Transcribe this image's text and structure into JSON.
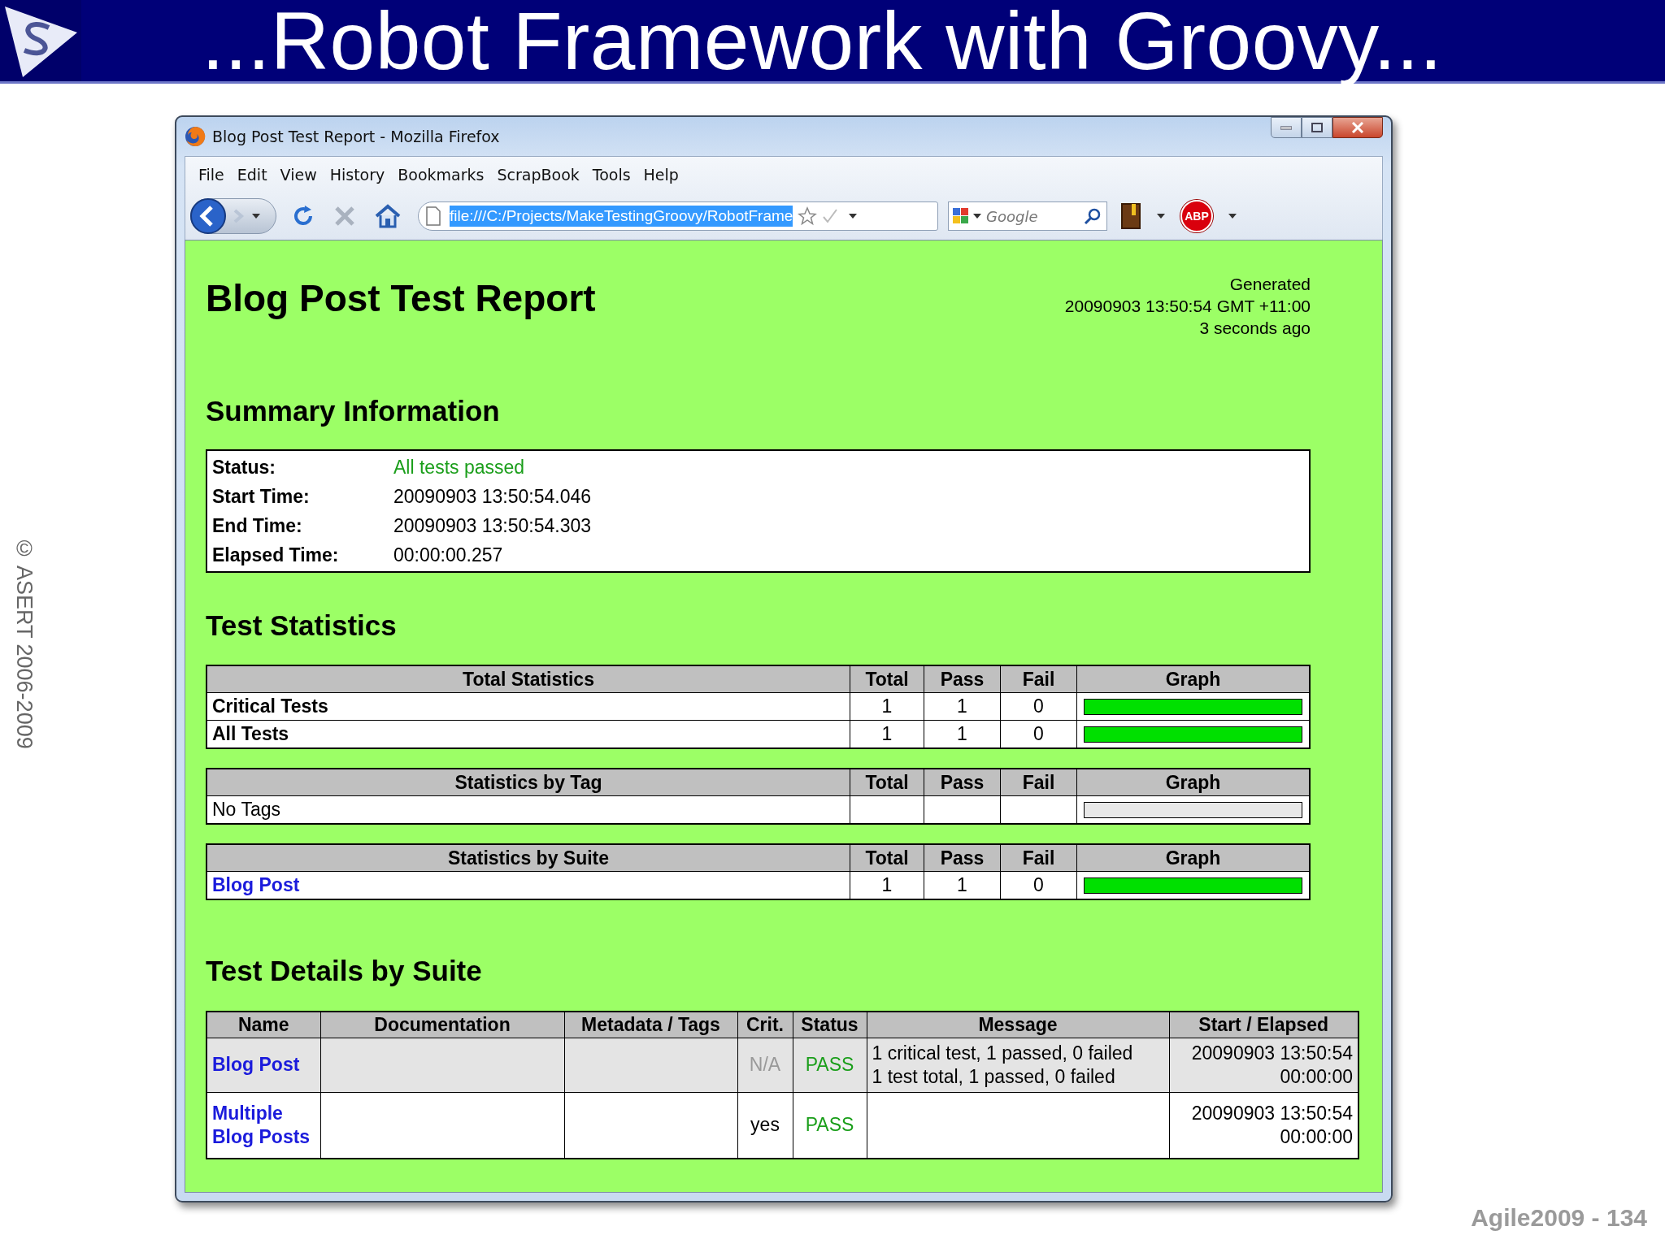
{
  "slide": {
    "title": "...Robot Framework with Groovy...",
    "copyright": "© ASERT 2006-2009",
    "footer": "Agile2009 - 134"
  },
  "browser": {
    "title": "Blog Post Test Report - Mozilla Firefox",
    "menu": [
      "File",
      "Edit",
      "View",
      "History",
      "Bookmarks",
      "ScrapBook",
      "Tools",
      "Help"
    ],
    "address": {
      "value": "file:///C:/Projects/MakeTestingGroovy/RobotFrame",
      "selected": true
    },
    "search": {
      "placeholder": "Google"
    },
    "addon_badge": "ABP"
  },
  "report": {
    "title": "Blog Post Test Report",
    "generated": [
      "Generated",
      "20090903 13:50:54 GMT +11:00",
      "3 seconds ago"
    ],
    "summary": {
      "heading": "Summary Information",
      "rows": [
        {
          "label": "Status:",
          "value": "All tests passed",
          "kind": "status"
        },
        {
          "label": "Start Time:",
          "value": "20090903 13:50:54.046",
          "kind": "plain"
        },
        {
          "label": "End Time:",
          "value": "20090903 13:50:54.303",
          "kind": "plain"
        },
        {
          "label": "Elapsed Time:",
          "value": "00:00:00.257",
          "kind": "plain"
        }
      ]
    },
    "statistics_heading": "Test Statistics",
    "statistics": [
      {
        "columns": [
          "Total Statistics",
          "Total",
          "Pass",
          "Fail",
          "Graph"
        ],
        "rows": [
          {
            "name": "Critical Tests",
            "kind": "bold",
            "total": "1",
            "pass": "1",
            "fail": "0",
            "level": 1
          },
          {
            "name": "All Tests",
            "kind": "bold",
            "total": "1",
            "pass": "1",
            "fail": "0",
            "level": 1
          }
        ]
      },
      {
        "columns": [
          "Statistics by Tag",
          "Total",
          "Pass",
          "Fail",
          "Graph"
        ],
        "rows": [
          {
            "name": "No Tags",
            "kind": "plain",
            "level": 0
          }
        ]
      },
      {
        "columns": [
          "Statistics by Suite",
          "Total",
          "Pass",
          "Fail",
          "Graph"
        ],
        "rows": [
          {
            "name": "Blog Post",
            "kind": "link",
            "total": "1",
            "pass": "1",
            "fail": "0",
            "level": 1
          }
        ]
      }
    ],
    "details": {
      "heading": "Test Details by Suite",
      "columns": [
        "Name",
        "Documentation",
        "Metadata / Tags",
        "Crit.",
        "Status",
        "Message",
        "Start / Elapsed"
      ],
      "rows": [
        {
          "name": "Blog Post",
          "kind": "suite",
          "crit": "N/A",
          "status": "PASS",
          "message": [
            "1 critical test, 1 passed, 0 failed",
            "1 test total, 1 passed, 0 failed"
          ],
          "start": "20090903 13:50:54",
          "elapsed": "00:00:00"
        },
        {
          "name": "Multiple Blog Posts",
          "kind": "test",
          "crit": "yes",
          "status": "PASS",
          "start": "20090903 13:50:54",
          "elapsed": "00:00:00"
        }
      ]
    }
  }
}
